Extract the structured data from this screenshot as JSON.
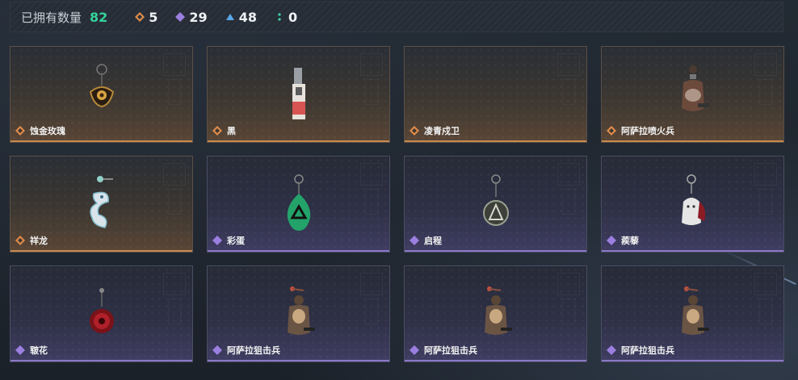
{
  "header": {
    "owned_label": "已拥有数量",
    "owned_count": "82",
    "rarities": [
      {
        "icon": "orange-diamond-icon",
        "color": "#e08b4a",
        "value": "5"
      },
      {
        "icon": "purple-diamond-icon",
        "color": "#9b7fe0",
        "value": "29"
      },
      {
        "icon": "blue-triangle-icon",
        "color": "#5aa7e8",
        "value": "48"
      },
      {
        "icon": "green-dots-icon",
        "color": "#3fd6a6",
        "value": "0"
      }
    ]
  },
  "colors": {
    "orange": "#e08b4a",
    "purple": "#9b7fe0",
    "count_green": "#34d39a"
  },
  "items": [
    {
      "name": "蚀金玫瑰",
      "rarity": "orange",
      "art": "golden-rose-charm"
    },
    {
      "name": "黑",
      "rarity": "orange",
      "art": "black-canister-charm"
    },
    {
      "name": "凌青戍卫",
      "rarity": "orange",
      "art": "empty"
    },
    {
      "name": "阿萨拉喷火兵",
      "rarity": "orange",
      "art": "flamethrower-figure-charm"
    },
    {
      "name": "祥龙",
      "rarity": "orange",
      "art": "dragon-charm"
    },
    {
      "name": "彩蛋",
      "rarity": "purple",
      "art": "green-egg-charm"
    },
    {
      "name": "启程",
      "rarity": "purple",
      "art": "round-badge-charm"
    },
    {
      "name": "蒺藜",
      "rarity": "purple",
      "art": "white-figure-charm"
    },
    {
      "name": "皲花",
      "rarity": "purple",
      "art": "red-flower-charm"
    },
    {
      "name": "阿萨拉狙击兵",
      "rarity": "purple",
      "art": "sniper-figure-charm"
    },
    {
      "name": "阿萨拉狙击兵",
      "rarity": "purple",
      "art": "sniper-figure-charm"
    },
    {
      "name": "阿萨拉狙击兵",
      "rarity": "purple",
      "art": "sniper-figure-charm"
    }
  ]
}
